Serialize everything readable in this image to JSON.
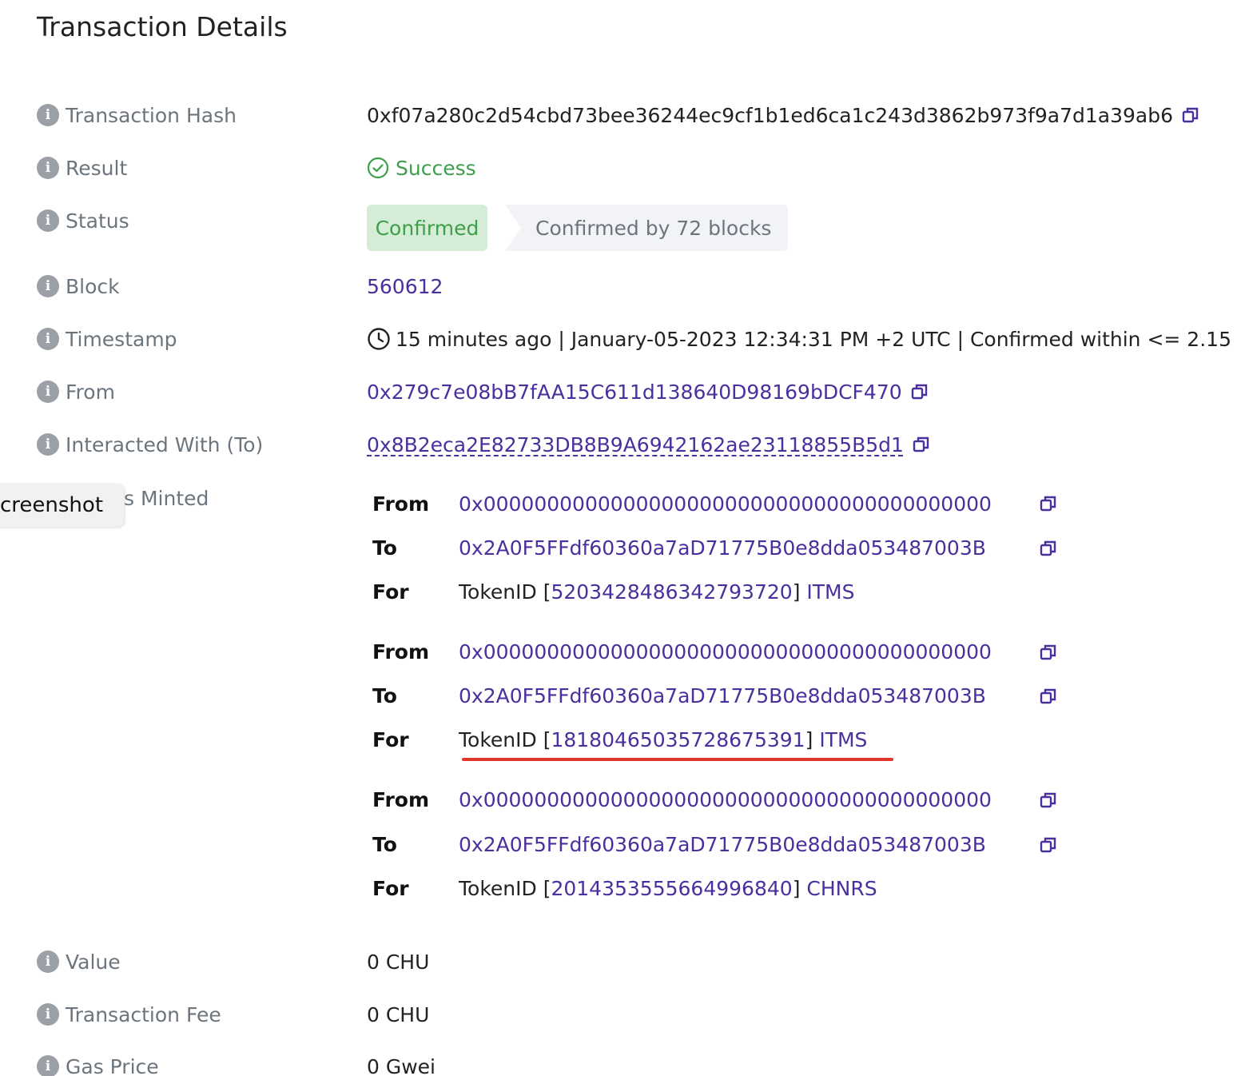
{
  "page_title": "Transaction Details",
  "labels": {
    "tx_hash": "Transaction Hash",
    "result": "Result",
    "status": "Status",
    "block": "Block",
    "timestamp": "Timestamp",
    "from": "From",
    "to": "Interacted With (To)",
    "minted_partial": "s Minted",
    "value": "Value",
    "fee": "Transaction Fee",
    "gas": "Gas Price"
  },
  "values": {
    "tx_hash": "0xf07a280c2d54cbd73bee36244ec9cf1b1ed6ca1c243d3862b973f9a7d1a39ab6",
    "result": "Success",
    "status_badge": "Confirmed",
    "status_blocks": "Confirmed by 72 blocks",
    "block": "560612",
    "timestamp": "15 minutes ago | January-05-2023 12:34:31 PM +2 UTC | Confirmed within <= 2.15",
    "from": "0x279c7e08bB7fAA15C611d138640D98169bDCF470",
    "to": "0x8B2eca2E82733DB8B9A6942162ae23118855B5d1",
    "value": "0 CHU",
    "fee": "0 CHU",
    "gas": "0 Gwei"
  },
  "tooltip_text": "creenshot",
  "transfer_keys": {
    "from": "From",
    "to": "To",
    "for": "For"
  },
  "transfers": [
    {
      "from": "0x0000000000000000000000000000000000000000",
      "to": "0x2A0F5FFdf60360a7aD71775B0e8dda053487003B",
      "token_prefix": "TokenID [",
      "token_id": "5203428486342793720",
      "token_bracket": "]",
      "token_symbol": "ITMS"
    },
    {
      "from": "0x0000000000000000000000000000000000000000",
      "to": "0x2A0F5FFdf60360a7aD71775B0e8dda053487003B",
      "token_prefix": "TokenID [",
      "token_id": "18180465035728675391",
      "token_bracket": "]",
      "token_symbol": "ITMS"
    },
    {
      "from": "0x0000000000000000000000000000000000000000",
      "to": "0x2A0F5FFdf60360a7aD71775B0e8dda053487003B",
      "token_prefix": "TokenID [",
      "token_id": "2014353555664996840",
      "token_bracket": "]",
      "token_symbol": "CHNRS"
    }
  ],
  "colors": {
    "link": "#4a2f9e",
    "success": "#3ea04a",
    "badge_confirmed_bg": "#d5ecd6",
    "badge_blocks_bg": "#f2f3f7",
    "label": "#6c757d",
    "highlight_underline": "#e0352b"
  },
  "icons": {
    "info": "info-circle-icon",
    "copy": "copy-icon",
    "success": "check-circle-icon",
    "clock": "clock-icon"
  }
}
